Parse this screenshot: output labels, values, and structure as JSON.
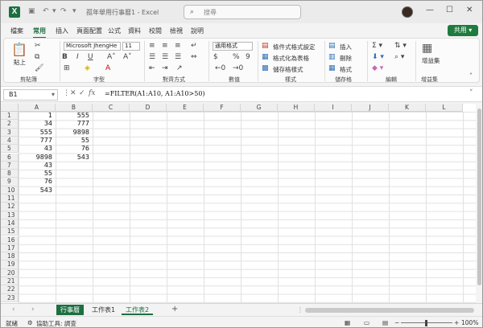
{
  "window": {
    "title": "孤年舉用行事曆1 - Excel",
    "search_placeholder": "搜尋"
  },
  "quick_access": [
    "save-icon",
    "undo-icon",
    "redo-icon"
  ],
  "ribbon_tabs": [
    "檔案",
    "常用",
    "插入",
    "頁面配置",
    "公式",
    "資料",
    "校閱",
    "檢視",
    "說明"
  ],
  "active_ribbon_tab": "常用",
  "share_label": "共用",
  "ribbon": {
    "clipboard": {
      "paste": "貼上",
      "group": "剪貼簿"
    },
    "font": {
      "name": "Microsoft JhengHe",
      "size": "11",
      "group": "字型"
    },
    "alignment": {
      "group": "對齊方式"
    },
    "number": {
      "format": "通用格式",
      "group": "數值"
    },
    "styles": {
      "cond": "條件式格式設定",
      "table": "格式化為表格",
      "cell": "儲存格樣式",
      "group": "樣式"
    },
    "cells": {
      "insert": "插入",
      "delete": "刪除",
      "format": "格式",
      "group": "儲存格"
    },
    "editing": {
      "group": "編輯"
    },
    "addins": {
      "label": "增益集",
      "group": "增益集"
    }
  },
  "formula_bar": {
    "name_box": "B1",
    "fx": "fx",
    "formula": "=FILTER(A1:A10, A1:A10>50)"
  },
  "grid": {
    "columns": [
      "A",
      "B",
      "C",
      "D",
      "E",
      "F",
      "G",
      "H",
      "I",
      "J",
      "K",
      "L"
    ],
    "rows": [
      "1",
      "2",
      "3",
      "4",
      "5",
      "6",
      "7",
      "8",
      "9",
      "10",
      "11",
      "12",
      "13",
      "14",
      "15",
      "16",
      "17",
      "18",
      "19",
      "20",
      "21",
      "22",
      "23"
    ],
    "col_a": [
      "1",
      "34",
      "555",
      "777",
      "43",
      "9898",
      "43",
      "55",
      "76",
      "543"
    ],
    "col_b": [
      "555",
      "777",
      "9898",
      "55",
      "76",
      "543"
    ]
  },
  "sheets": [
    "行事曆",
    "工作表1",
    "工作表2"
  ],
  "active_sheet": "工作表2",
  "status": {
    "ready": "就緒",
    "accessibility": "協助工具: 調查",
    "zoom": "100%"
  }
}
